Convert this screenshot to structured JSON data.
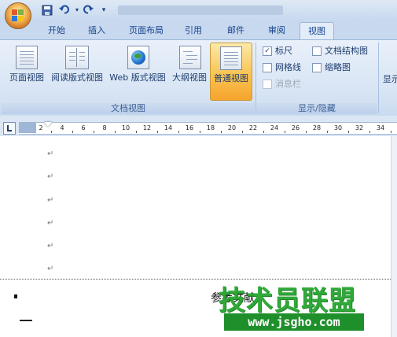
{
  "quick_access": {
    "save_icon": "save-icon",
    "undo_icon": "undo-icon",
    "redo_icon": "redo-icon"
  },
  "tabs": [
    {
      "label": "开始"
    },
    {
      "label": "插入"
    },
    {
      "label": "页面布局"
    },
    {
      "label": "引用"
    },
    {
      "label": "邮件"
    },
    {
      "label": "审阅"
    },
    {
      "label": "视图",
      "active": true
    }
  ],
  "ribbon": {
    "doc_views": {
      "group_label": "文档视图",
      "buttons": [
        {
          "label": "页面视图",
          "icon": "page-layout-icon"
        },
        {
          "label": "阅读版式视图",
          "icon": "full-screen-reading-icon"
        },
        {
          "label": "Web 版式视图",
          "icon": "web-layout-icon"
        },
        {
          "label": "大纲视图",
          "icon": "outline-icon"
        },
        {
          "label": "普通视图",
          "icon": "draft-icon",
          "selected": true
        }
      ]
    },
    "show_hide": {
      "group_label": "显示/隐藏",
      "items": [
        {
          "label": "标尺",
          "checked": true
        },
        {
          "label": "文档结构图",
          "checked": false
        },
        {
          "label": "网格线",
          "checked": false
        },
        {
          "label": "缩略图",
          "checked": false
        },
        {
          "label": "消息栏",
          "checked": false,
          "disabled": true
        }
      ]
    },
    "next_group_partial": "显示"
  },
  "ruler": {
    "ticks": [
      "2",
      "4",
      "6",
      "8",
      "10",
      "12",
      "14",
      "16",
      "18",
      "20",
      "22",
      "24",
      "26",
      "28",
      "30",
      "32",
      "34"
    ]
  },
  "document": {
    "paragraph_mark": "↵",
    "reference_text": "参考文献"
  },
  "watermark": {
    "text": "技术员联盟",
    "url": "www.jsgho.com"
  }
}
